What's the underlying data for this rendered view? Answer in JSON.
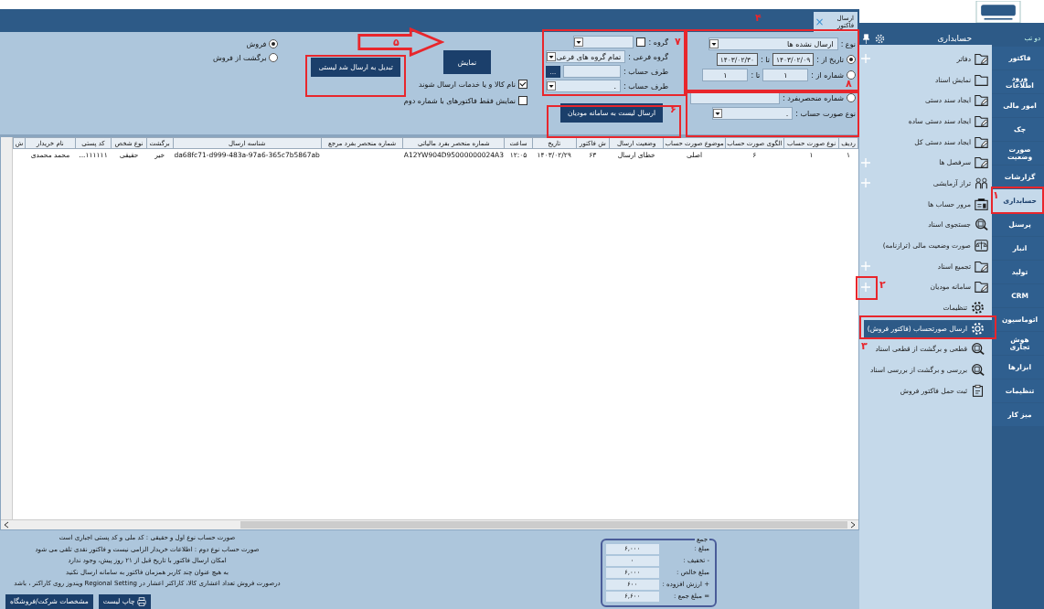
{
  "title_tab": {
    "label": "ارسال فاکتور",
    "close": "×"
  },
  "sidebar": {
    "title": "حسابداری",
    "dock_label": "دو تب",
    "vertical_tabs": [
      {
        "label": "فاکتور",
        "selected": false
      },
      {
        "label": "ورود اطلاعات",
        "selected": false
      },
      {
        "label": "امور مالی",
        "selected": false
      },
      {
        "label": "چک",
        "selected": false
      },
      {
        "label": "صورت وضعیت",
        "selected": false
      },
      {
        "label": "گزارشات",
        "selected": false
      },
      {
        "label": "حسابداری",
        "selected": true
      },
      {
        "label": "پرسنل",
        "selected": false
      },
      {
        "label": "انبار",
        "selected": false
      },
      {
        "label": "تولید",
        "selected": false
      },
      {
        "label": "CRM",
        "selected": false
      },
      {
        "label": "اتوماسیون",
        "selected": false
      },
      {
        "label": "هوش تجاری",
        "selected": false
      },
      {
        "label": "ابزارها",
        "selected": false
      },
      {
        "label": "تنظیمات",
        "selected": false
      },
      {
        "label": "میز کار",
        "selected": false
      }
    ],
    "items": [
      {
        "label": "دفاتر",
        "expandable": true,
        "selected": false
      },
      {
        "label": "نمایش اسناد",
        "expandable": false,
        "selected": false
      },
      {
        "label": "ایجاد سند دستی",
        "expandable": false,
        "selected": false
      },
      {
        "label": "ایجاد سند دستی ساده",
        "expandable": false,
        "selected": false
      },
      {
        "label": "ایجاد سند دستی کل",
        "expandable": false,
        "selected": false
      },
      {
        "label": "سرفصل ها",
        "expandable": true,
        "selected": false
      },
      {
        "label": "تراز آزمایشی",
        "expandable": true,
        "selected": false
      },
      {
        "label": "مرور حساب ها",
        "expandable": false,
        "selected": false
      },
      {
        "label": "جستجوی اسناد",
        "expandable": false,
        "selected": false
      },
      {
        "label": "صورت وضعیت مالی (ترازنامه)",
        "expandable": false,
        "selected": false
      },
      {
        "label": "تجمیع اسناد",
        "expandable": true,
        "selected": false
      },
      {
        "label": "سامانه مودیان",
        "expandable": true,
        "selected": false,
        "children": [
          {
            "label": "تنظیمات",
            "selected": false
          },
          {
            "label": "ارسال صورتحساب (فاکتور فروش)",
            "selected": true
          },
          {
            "label": "قطعی و برگشت از قطعی اسناد",
            "selected": false
          },
          {
            "label": "بررسی و برگشت از بررسی اسناد",
            "selected": false
          },
          {
            "label": "ثبت حمل فاکتور فروش",
            "selected": false
          }
        ]
      }
    ]
  },
  "filter": {
    "type_label": "نوع :",
    "type_value": "ارسال نشده ها",
    "date_radio": {
      "label": "تاریخ از :",
      "selected": true
    },
    "date_from": "۱۴۰۳/۰۲/۰۹",
    "date_to_label": "تا :",
    "date_to": "۱۴۰۳/۰۲/۳۰",
    "number_radio": {
      "label": "شماره از :",
      "selected": false
    },
    "number_from": "۱",
    "number_to_label": "تا :",
    "number_to": "۱",
    "unique_radio": {
      "label": "شماره منحصربفرد :",
      "selected": false
    },
    "invoice_type_label": "نوع صورت حساب :",
    "invoice_type_value": "."
  },
  "group": {
    "group_label": "گروه :",
    "group_checked": false,
    "subgroup_label": "گروه فرعی :",
    "subgroup_value": "تمام گروه های فرعی",
    "party_label": "طرف حساب :",
    "browse": "...",
    "party2_label": "طرف حساب :",
    "party2_value": "."
  },
  "send_button": "ارسال لیست به سامانه مودیان",
  "show_button": "نمایش",
  "options": [
    {
      "label": "نام کالا و یا خدمات ارسال شوند",
      "checked": true
    },
    {
      "label": "نمایش فقط فاکتورهای با شماره دوم",
      "checked": false
    }
  ],
  "convert_button": "تبدیل به ارسال شد لیستی",
  "sale_type": [
    {
      "label": "فروش",
      "selected": true
    },
    {
      "label": "برگشت از فروش",
      "selected": false
    }
  ],
  "table": {
    "columns": [
      "ردیف",
      "نوع صورت حساب",
      "الگوی صورت حساب",
      "موضوع صورت حساب",
      "وضعیت ارسال",
      "ش فاکتور",
      "تاریخ",
      "ساعت",
      "شماره منحصر بفرد مالیاتی",
      "شماره منحصر بفرد مرجع",
      "شناسه ارسال",
      "برگشت",
      "نوع شخص",
      "کد پستی",
      "نام خریدار",
      "ش"
    ],
    "rows": [
      [
        "۱",
        "۱",
        "۶",
        "اصلی",
        "خطای ارسال",
        "۶۳",
        "۱۴۰۳/۰۲/۲۹",
        "۱۲:۰۵",
        "A12YW904D95000000024A3",
        "",
        "da68fc71-d999-483a-97a6-365c7b5867ab",
        "خیر",
        "حقیقی",
        "۱۱۱۱۱۱...",
        "محمد محمدی",
        ""
      ]
    ]
  },
  "notes": [
    "صورت حساب نوع اول و حقیقی : کد ملی و کد پستی اجباری است",
    "صورت حساب نوع دوم : اطلاعات خریدار الزامی نیست و فاکتور نقدی تلقی می شود",
    "امکان ارسال فاکتور با تاریخ قبل از ۲۱ روز پیش، وجود ندارد",
    "به هیچ عنوان چند کاربر همزمان فاکتور به سامانه ارسال نکنید",
    "درصورت فروش تعداد اعشاری کالا، کاراکتر اعشار در Regional Setting ویندوز روی کاراکتر ، باشد"
  ],
  "company_button": "مشخصات شرکت/فروشگاه",
  "print_button": "چاپ لیست",
  "totals": {
    "title": "جمع",
    "rows": [
      {
        "label": "مبلغ :",
        "value": "۶,۰۰۰"
      },
      {
        "label": "- تخفیف :",
        "value": "۰"
      },
      {
        "label": "مبلغ خالص :",
        "value": "۶,۰۰۰"
      },
      {
        "label": "+ ارزش افزوده :",
        "value": "۶۰۰"
      },
      {
        "label": "= مبلغ جمع :",
        "value": "۶,۶۰۰"
      }
    ]
  },
  "annotations": [
    "۱",
    "۲",
    "۳",
    "۴",
    "۵",
    "۶",
    "۷",
    "۸"
  ]
}
